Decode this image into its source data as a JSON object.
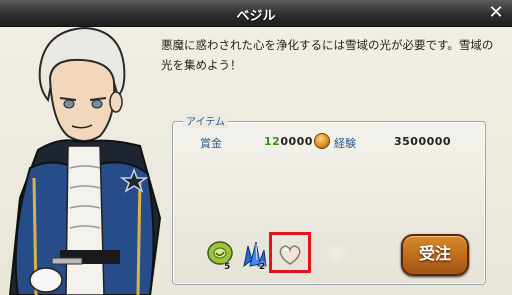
{
  "dialog": {
    "title": "ベジル",
    "close_label": "✕",
    "message": "悪魔に惑わされた心を浄化するには雪域の光が必要です。雪域の光を集めよう！"
  },
  "items_panel": {
    "label": "アイテム",
    "reward_label": "賞金",
    "money_value_green": "12",
    "money_value_rest": "0000",
    "exp_label": "経験",
    "exp_value": "3500000"
  },
  "reward_items": [
    {
      "icon": "green-orb-icon",
      "count": "5"
    },
    {
      "icon": "blue-crystal-icon",
      "count": "2"
    },
    {
      "icon": "heart-stone-icon",
      "count": ""
    }
  ],
  "accept_button": "受注",
  "colors": {
    "titlebar": "#2e2e2e",
    "accent_blue": "#2f5a8e",
    "highlight_red": "#e0151b",
    "button_orange": "#c06a1e"
  }
}
